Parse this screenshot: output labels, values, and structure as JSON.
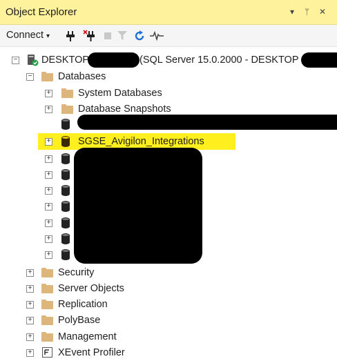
{
  "window": {
    "title": "Object Explorer",
    "pin_glyph": "▾ ᛗ ✕"
  },
  "toolbar": {
    "connect_label": "Connect",
    "connect_arrow": "▾",
    "icons": [
      "connect-icon",
      "disconnect-icon",
      "stop-icon",
      "filter-icon",
      "refresh-icon",
      "activity-monitor-icon"
    ]
  },
  "tree": {
    "server": {
      "label_prefix": "DESKTOP",
      "label_suffix": "(SQL Server 15.0.2000 - DESKTOP",
      "expander": "−"
    },
    "databases": {
      "label": "Databases",
      "expander": "−"
    },
    "system_databases": {
      "label": "System Databases",
      "expander": "+"
    },
    "database_snapshots": {
      "label": "Database Snapshots",
      "expander": "+"
    },
    "highlighted_db": {
      "label": "SGSE_Avigilon_Integrations",
      "expander": "+"
    },
    "other_nodes": [
      {
        "label": "Security",
        "expander": "+"
      },
      {
        "label": "Server Objects",
        "expander": "+"
      },
      {
        "label": "Replication",
        "expander": "+"
      },
      {
        "label": "PolyBase",
        "expander": "+"
      },
      {
        "label": "Management",
        "expander": "+"
      },
      {
        "label": "XEvent Profiler",
        "expander": "+"
      }
    ]
  },
  "colors": {
    "titlebar": "#fff29d",
    "highlight": "#ffef1f",
    "folder": "#dcb67a",
    "refresh": "#1e6fd9"
  }
}
